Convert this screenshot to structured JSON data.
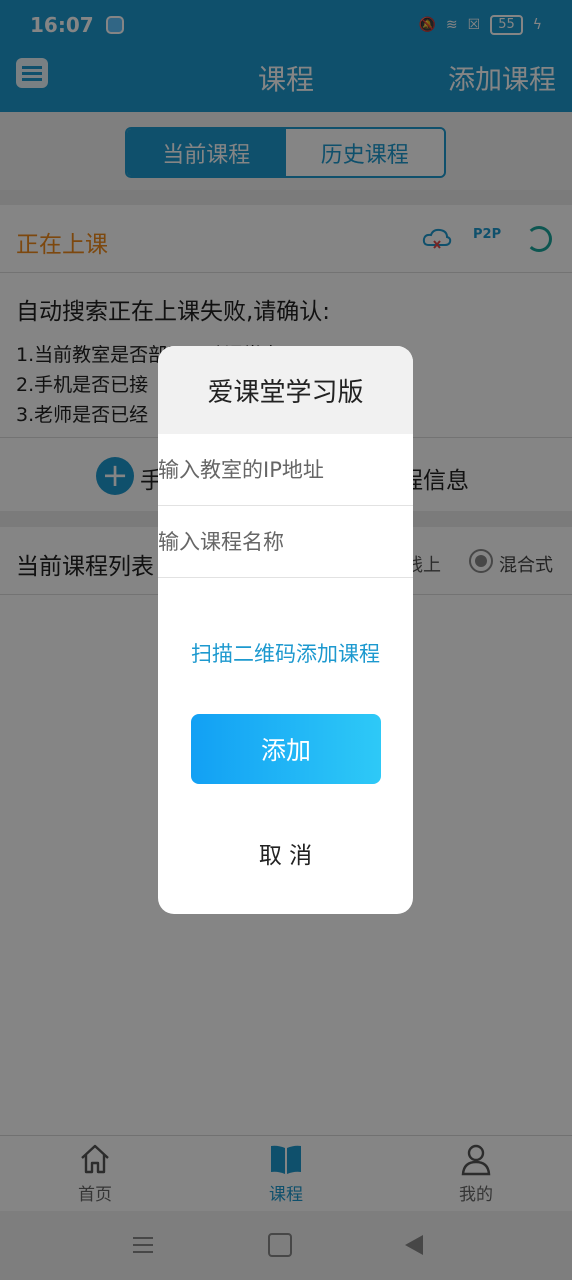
{
  "status_bar": {
    "time": "16:07",
    "battery": "55"
  },
  "header": {
    "title": "课程",
    "action": "添加课程"
  },
  "segmented": {
    "current": "当前课程",
    "history": "历史课程"
  },
  "live": {
    "title": "正在上课",
    "p2p_label": "P2P"
  },
  "warning": {
    "title": "自动搜索正在上课失败,请确认:",
    "line1": "1.当前教室是否部署互动课堂专用WIFI",
    "line2": "2.手机是否已接",
    "line3": "3.老师是否已经"
  },
  "manual": {
    "left": "手",
    "right": "程信息"
  },
  "course_list": {
    "title": "当前课程列表",
    "option_online": "线上",
    "option_mixed": "混合式"
  },
  "dialog": {
    "title": "爱课堂学习版",
    "ip_placeholder": "输入教室的IP地址",
    "name_placeholder": "输入课程名称",
    "scan_link": "扫描二维码添加课程",
    "add_button": "添加",
    "cancel_button": "取 消"
  },
  "tabbar": {
    "home": "首页",
    "course": "课程",
    "mine": "我的"
  },
  "colors": {
    "primary": "#1d99cf",
    "accent_orange": "#ef8b1b"
  }
}
